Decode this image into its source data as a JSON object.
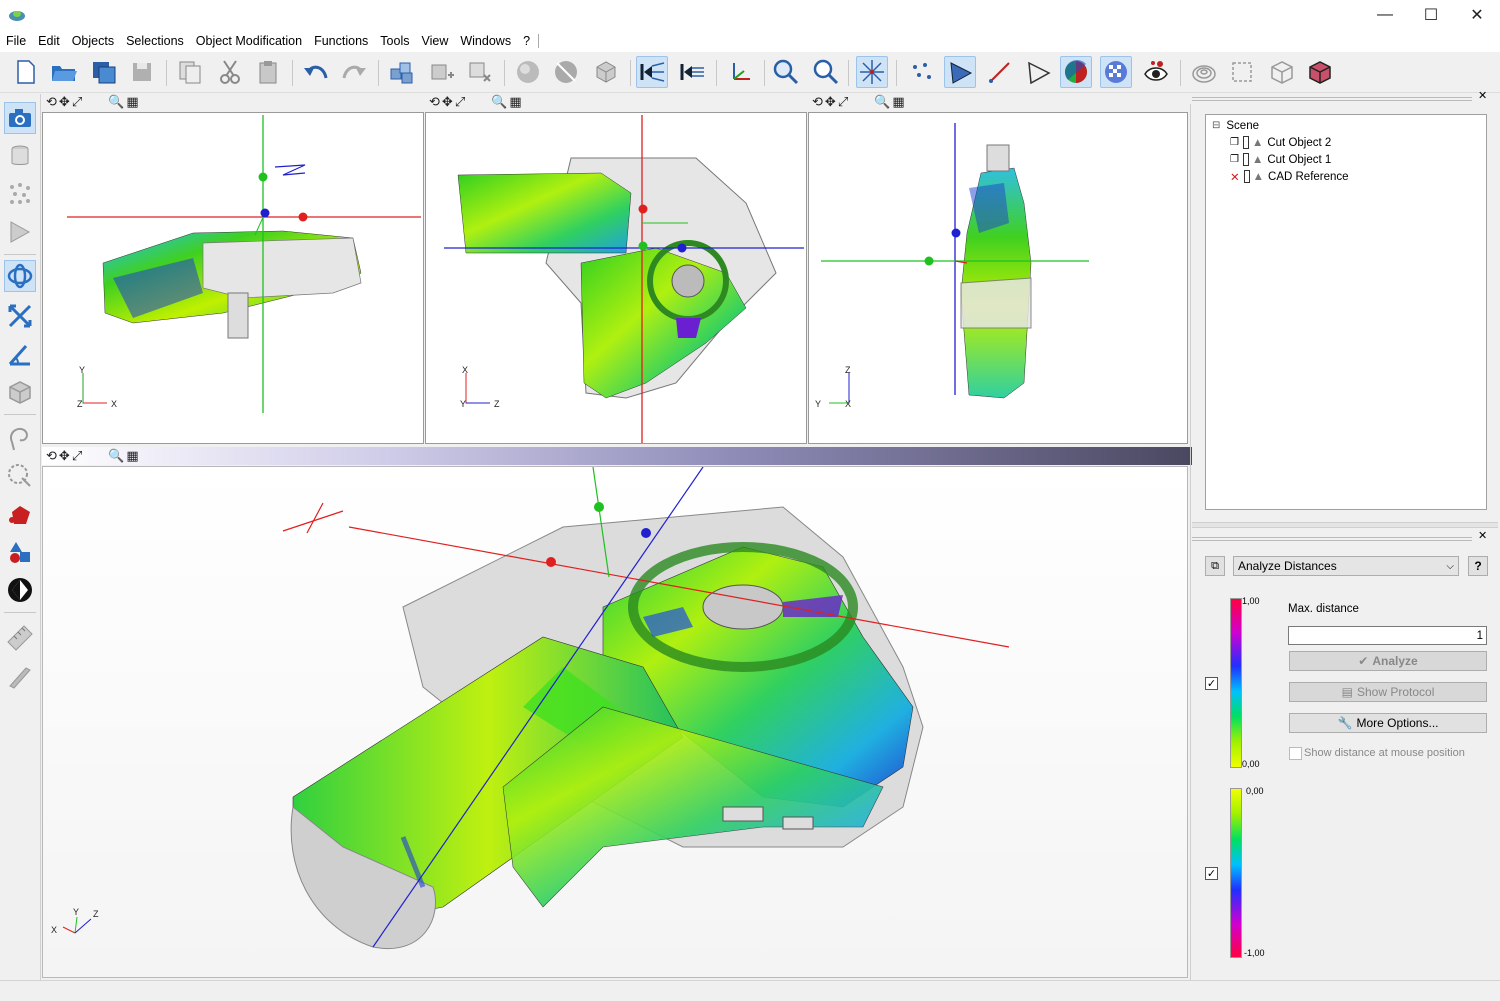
{
  "menu": [
    "File",
    "Edit",
    "Objects",
    "Selections",
    "Object Modification",
    "Functions",
    "Tools",
    "View",
    "Windows",
    "?"
  ],
  "window_controls": {
    "minimize": "—",
    "maximize": "☐",
    "close": "✕"
  },
  "viewports": {
    "top_left": {
      "axis_v": "Y",
      "axis_h": "X",
      "axis_d": "Z"
    },
    "top_middle": {
      "axis_v": "X",
      "axis_h": "Z",
      "axis_d": "Y"
    },
    "top_right": {
      "axis_v": "Z",
      "axis_h": "Y",
      "axis_d": "X"
    },
    "main": {
      "axis_a": "Y",
      "axis_b": "Z",
      "axis_c": "X"
    }
  },
  "scene": {
    "root": "Scene",
    "items": [
      {
        "label": "Cut Object 2",
        "state": "visible"
      },
      {
        "label": "Cut Object 1",
        "state": "visible"
      },
      {
        "label": "CAD Reference",
        "state": "hidden"
      }
    ]
  },
  "analysis": {
    "function": "Analyze Distances",
    "help": "?",
    "max_distance_label": "Max. distance",
    "max_distance_value": "1",
    "analyze_button": "Analyze",
    "show_protocol_button": "Show Protocol",
    "more_options_button": "More Options...",
    "show_distance_label": "Show distance at mouse position",
    "scale1_top": "1,00",
    "scale1_bottom": "0,00",
    "scale2_top": "0,00",
    "scale2_bottom": "-1,00"
  },
  "colors": {
    "x_axis": "#e02020",
    "y_axis": "#20c020",
    "z_axis": "#2020d0",
    "accent": "#cfe3f7"
  }
}
